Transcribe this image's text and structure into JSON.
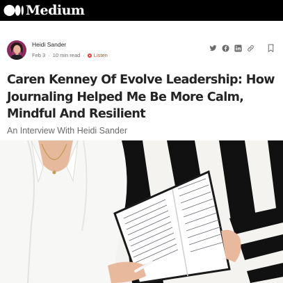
{
  "brand": {
    "name": "Medium",
    "logo_icon": "medium-logo-icon"
  },
  "author": {
    "name": "Heidi Sander",
    "avatar_icon": "avatar"
  },
  "meta": {
    "date": "Feb 3",
    "separator": "·",
    "read_time": "10 min read",
    "listen_label": "Listen"
  },
  "share": {
    "icons": [
      "twitter-icon",
      "facebook-icon",
      "linkedin-icon",
      "link-icon",
      "bookmark-icon"
    ]
  },
  "article": {
    "title": "Caren Kenney Of Evolve Leadership: How Journaling Helped Me Be More Calm, Mindful And Resilient",
    "subtitle": "An Interview With Heidi Sander"
  },
  "colors": {
    "topbar": "#000000",
    "text_primary": "#242424",
    "text_secondary": "#6b6b6b",
    "listen_accent": "#e53935"
  }
}
